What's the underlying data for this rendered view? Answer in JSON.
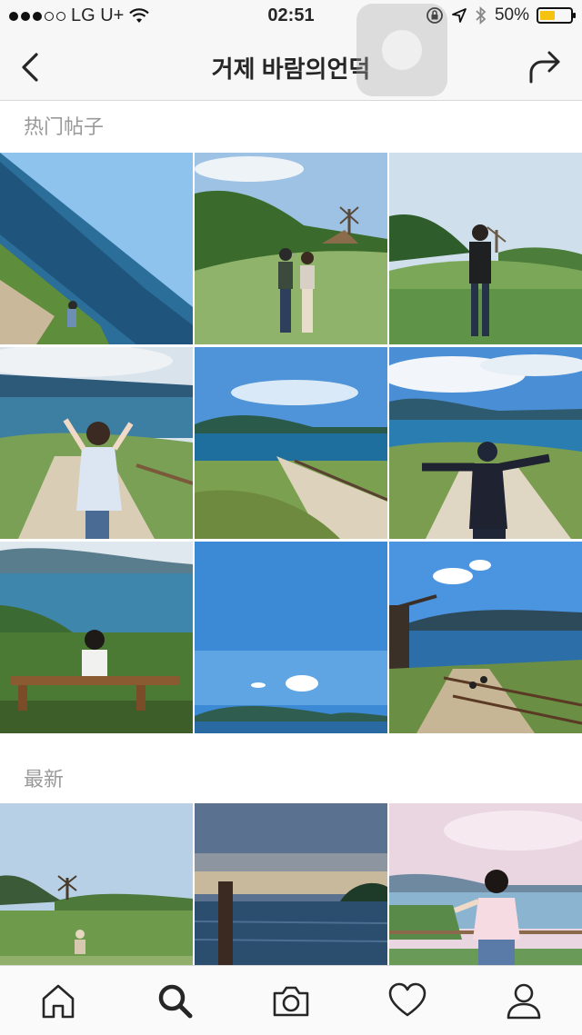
{
  "status_bar": {
    "carrier": "LG U+",
    "time": "02:51",
    "battery_percent": "50%",
    "battery_level": 0.5,
    "signal_bars": 3,
    "icons": [
      "signal-dots-icon",
      "wifi-icon",
      "orientation-lock-icon",
      "location-arrow-icon",
      "bluetooth-icon",
      "battery-icon"
    ]
  },
  "nav": {
    "title": "거제 바람의언덕",
    "back_icon": "chevron-left-icon",
    "share_icon": "share-arrow-icon"
  },
  "sections": {
    "top_posts": "热门帖子",
    "most_recent": "最新"
  },
  "top_posts": [
    {
      "subject": "coastline tilted view"
    },
    {
      "subject": "couple with windmill"
    },
    {
      "subject": "man near windmill hill"
    },
    {
      "subject": "woman on path by sea"
    },
    {
      "subject": "sea and islands path"
    },
    {
      "subject": "man with arms spread"
    },
    {
      "subject": "person on bench facing sea"
    },
    {
      "subject": "blue sky and island"
    },
    {
      "subject": "windmill and stairs"
    }
  ],
  "most_recent": [
    {
      "subject": "windmill hill"
    },
    {
      "subject": "sunset sea post"
    },
    {
      "subject": "woman by the sea"
    }
  ],
  "tab_bar": [
    {
      "name": "home",
      "icon": "home-icon",
      "active": false
    },
    {
      "name": "search",
      "icon": "search-icon",
      "active": true
    },
    {
      "name": "camera",
      "icon": "camera-icon",
      "active": false
    },
    {
      "name": "activity",
      "icon": "heart-icon",
      "active": false
    },
    {
      "name": "profile",
      "icon": "profile-icon",
      "active": false
    }
  ],
  "colors": {
    "bar_background": "#f7f7f7",
    "section_text": "#9a9a9a",
    "battery": "#f5c30f",
    "sky": "#6ea6e0",
    "sea": "#2e6f9c",
    "grass": "#6e9a47"
  }
}
